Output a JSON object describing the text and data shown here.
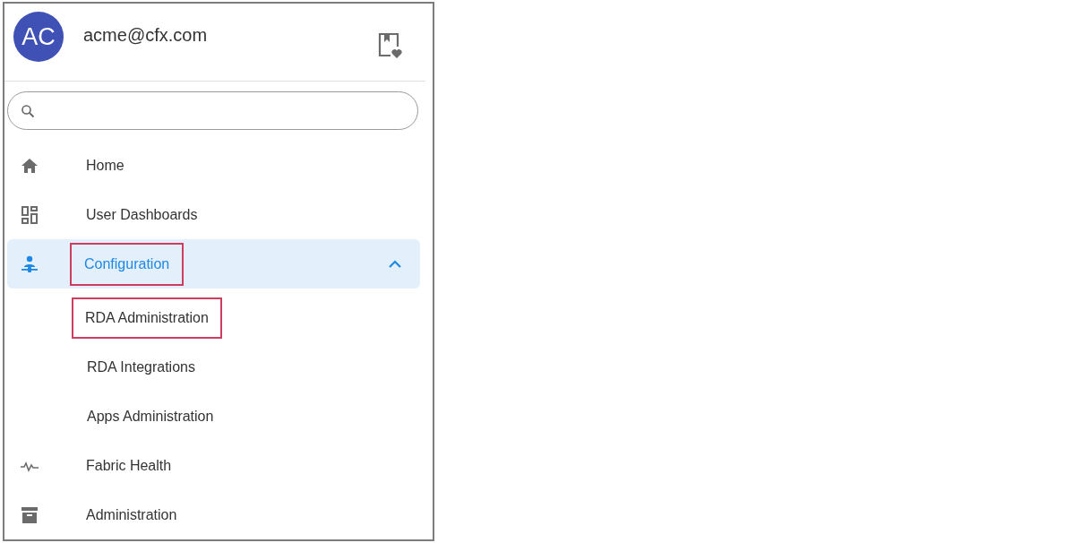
{
  "header": {
    "avatar": "AC",
    "email": "acme@cfx.com"
  },
  "nav": [
    {
      "kind": "home",
      "label": "Home",
      "selected": false,
      "highlighted": false
    },
    {
      "kind": "dashboards",
      "label": "User Dashboards",
      "selected": false,
      "highlighted": false
    },
    {
      "kind": "configuration",
      "label": "Configuration",
      "selected": true,
      "highlighted": true,
      "expanded": true,
      "children": [
        {
          "label": "RDA Administration",
          "selected": false,
          "highlighted": true
        },
        {
          "label": "RDA Integrations",
          "selected": false,
          "highlighted": false
        },
        {
          "label": "Apps Administration",
          "selected": false,
          "highlighted": false
        }
      ]
    },
    {
      "kind": "health",
      "label": "Fabric Health",
      "selected": false,
      "highlighted": false
    },
    {
      "kind": "archive",
      "label": "Administration",
      "selected": false,
      "highlighted": false
    }
  ]
}
